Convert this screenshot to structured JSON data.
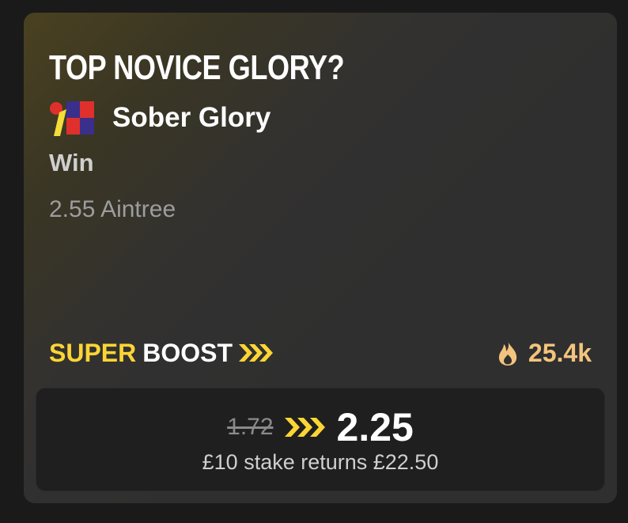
{
  "card": {
    "title": "TOP NOVICE GLORY?",
    "selection": {
      "silks_icon": "racing-silks-icon",
      "horse_name": "Sober Glory"
    },
    "market": "Win",
    "event": "2.55 Aintree",
    "boost": {
      "super": "SUPER",
      "word": "BOOST",
      "icon": "chevrons-right-icon"
    },
    "popularity": {
      "icon": "flame-icon",
      "count": "25.4k"
    },
    "odds": {
      "old": "1.72",
      "new": "2.25",
      "returns": "£10 stake returns £22.50"
    }
  },
  "colors": {
    "accent_yellow": "#fcd535",
    "popularity_orange": "#f3c47e",
    "card_bg": "#2f2f2f",
    "odds_box_bg": "#1f1f1f",
    "page_bg": "#1a1a1a"
  }
}
